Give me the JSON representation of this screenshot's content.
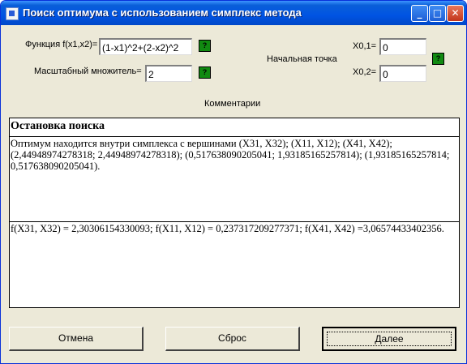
{
  "window": {
    "title": "Поиск оптимума с использованием симплекс метода",
    "buttons": {
      "minimize": "_",
      "maximize": "□",
      "close": "✕"
    }
  },
  "params": {
    "function_label": "Функция f(x1,x2)=",
    "function_value": "(1-x1)^2+(2-x2)^2",
    "scale_label": "Масштабный множитель=",
    "scale_value": "2",
    "start_point_label": "Начальная точка",
    "x01_label": "X0,1=",
    "x01_value": "0",
    "x02_label": "X0,2=",
    "x02_value": "0",
    "comments_label": "Комментарии",
    "apply_button_label": "?"
  },
  "comments": {
    "header": "Остановка поиска",
    "text": "Оптимум находится внутри симплекса с вершинами (X31, X32); (X11, X12); (X41, X42); (2,44948974278318; 2,44948974278318); (0,517638090205041; 1,93185165257814); (1,93185165257814; 0,517638090205041).",
    "values_text": "f(X31, X32) = 2,30306154330093; f(X11, X12) = 0,237317209277371; f(X41, X42) =3,06574433402356."
  },
  "actions": {
    "cancel": "Отмена",
    "reset": "Сброс",
    "next": "Далее"
  }
}
